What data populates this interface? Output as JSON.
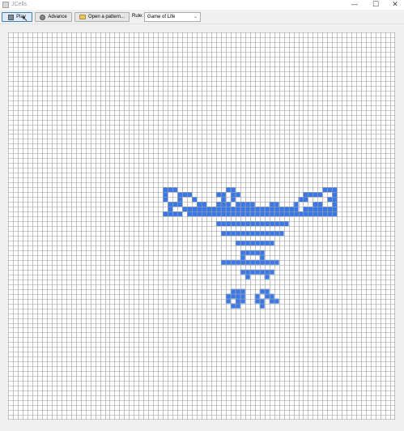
{
  "window": {
    "title": "JCells",
    "minimize_glyph": "—",
    "maximize_glyph": "☐",
    "close_glyph": "✕"
  },
  "toolbar": {
    "play_label": "Play",
    "advance_label": "Advance",
    "open_label": "Open a pattern...",
    "rule_label": "Rule:",
    "rule_value": "Game of Life"
  },
  "icons": {
    "play": "play-icon",
    "advance": "advance-icon",
    "open": "folder-icon"
  },
  "colors": {
    "live_cell": "#3b78e7",
    "grid_line": "#9a9a9a",
    "background": "#ffffff"
  },
  "board": {
    "cols": 80,
    "rows": 80,
    "live_cells": [
      [
        65,
        32
      ],
      [
        66,
        32
      ],
      [
        67,
        32
      ],
      [
        61,
        33
      ],
      [
        62,
        33
      ],
      [
        63,
        33
      ],
      [
        64,
        33
      ],
      [
        67,
        33
      ],
      [
        35,
        33
      ],
      [
        36,
        33
      ],
      [
        37,
        33
      ],
      [
        35,
        34
      ],
      [
        38,
        34
      ],
      [
        60,
        34
      ],
      [
        61,
        34
      ],
      [
        66,
        34
      ],
      [
        67,
        34
      ],
      [
        54,
        35
      ],
      [
        55,
        35
      ],
      [
        59,
        35
      ],
      [
        63,
        35
      ],
      [
        64,
        35
      ],
      [
        67,
        35
      ],
      [
        45,
        32
      ],
      [
        46,
        32
      ],
      [
        43,
        33
      ],
      [
        44,
        33
      ],
      [
        46,
        33
      ],
      [
        47,
        33
      ],
      [
        44,
        34
      ],
      [
        46,
        34
      ],
      [
        44,
        35
      ],
      [
        45,
        35
      ],
      [
        47,
        35
      ],
      [
        48,
        35
      ],
      [
        49,
        35
      ],
      [
        50,
        35
      ],
      [
        39,
        35
      ],
      [
        40,
        35
      ],
      [
        43,
        35
      ],
      [
        32,
        32
      ],
      [
        33,
        32
      ],
      [
        34,
        32
      ],
      [
        32,
        33
      ],
      [
        35,
        33
      ],
      [
        32,
        34
      ],
      [
        33,
        35
      ],
      [
        34,
        35
      ],
      [
        35,
        35
      ],
      [
        33,
        36
      ],
      [
        36,
        36
      ],
      [
        38,
        36
      ],
      [
        37,
        36
      ],
      [
        38,
        36
      ],
      [
        39,
        36
      ],
      [
        40,
        36
      ],
      [
        41,
        36
      ],
      [
        42,
        36
      ],
      [
        43,
        36
      ],
      [
        44,
        36
      ],
      [
        45,
        36
      ],
      [
        46,
        36
      ],
      [
        47,
        36
      ],
      [
        48,
        36
      ],
      [
        49,
        36
      ],
      [
        50,
        36
      ],
      [
        51,
        36
      ],
      [
        52,
        36
      ],
      [
        53,
        36
      ],
      [
        54,
        36
      ],
      [
        55,
        36
      ],
      [
        56,
        36
      ],
      [
        57,
        36
      ],
      [
        58,
        36
      ],
      [
        59,
        36
      ],
      [
        61,
        36
      ],
      [
        62,
        36
      ],
      [
        63,
        36
      ],
      [
        64,
        36
      ],
      [
        65,
        36
      ],
      [
        66,
        36
      ],
      [
        67,
        36
      ],
      [
        32,
        37
      ],
      [
        33,
        37
      ],
      [
        34,
        37
      ],
      [
        35,
        37
      ],
      [
        37,
        37
      ],
      [
        38,
        37
      ],
      [
        39,
        37
      ],
      [
        40,
        37
      ],
      [
        41,
        37
      ],
      [
        42,
        37
      ],
      [
        43,
        37
      ],
      [
        44,
        37
      ],
      [
        45,
        37
      ],
      [
        46,
        37
      ],
      [
        47,
        37
      ],
      [
        48,
        37
      ],
      [
        49,
        37
      ],
      [
        50,
        37
      ],
      [
        51,
        37
      ],
      [
        52,
        37
      ],
      [
        53,
        37
      ],
      [
        54,
        37
      ],
      [
        55,
        37
      ],
      [
        56,
        37
      ],
      [
        57,
        37
      ],
      [
        58,
        37
      ],
      [
        59,
        37
      ],
      [
        60,
        37
      ],
      [
        61,
        37
      ],
      [
        62,
        37
      ],
      [
        63,
        37
      ],
      [
        64,
        37
      ],
      [
        65,
        37
      ],
      [
        66,
        37
      ],
      [
        67,
        37
      ],
      [
        43,
        39
      ],
      [
        44,
        39
      ],
      [
        45,
        39
      ],
      [
        46,
        39
      ],
      [
        47,
        39
      ],
      [
        48,
        39
      ],
      [
        49,
        39
      ],
      [
        50,
        39
      ],
      [
        51,
        39
      ],
      [
        52,
        39
      ],
      [
        53,
        39
      ],
      [
        54,
        39
      ],
      [
        55,
        39
      ],
      [
        56,
        39
      ],
      [
        57,
        39
      ],
      [
        44,
        41
      ],
      [
        45,
        41
      ],
      [
        46,
        41
      ],
      [
        47,
        41
      ],
      [
        48,
        41
      ],
      [
        49,
        41
      ],
      [
        50,
        41
      ],
      [
        51,
        41
      ],
      [
        52,
        41
      ],
      [
        53,
        41
      ],
      [
        54,
        41
      ],
      [
        55,
        41
      ],
      [
        56,
        41
      ],
      [
        47,
        43
      ],
      [
        48,
        43
      ],
      [
        49,
        43
      ],
      [
        50,
        43
      ],
      [
        51,
        43
      ],
      [
        52,
        43
      ],
      [
        53,
        43
      ],
      [
        54,
        43
      ],
      [
        48,
        45
      ],
      [
        49,
        45
      ],
      [
        50,
        45
      ],
      [
        51,
        45
      ],
      [
        52,
        45
      ],
      [
        48,
        46
      ],
      [
        52,
        46
      ],
      [
        44,
        47
      ],
      [
        45,
        47
      ],
      [
        46,
        47
      ],
      [
        47,
        47
      ],
      [
        48,
        47
      ],
      [
        49,
        47
      ],
      [
        50,
        47
      ],
      [
        51,
        47
      ],
      [
        52,
        47
      ],
      [
        53,
        47
      ],
      [
        54,
        47
      ],
      [
        55,
        47
      ],
      [
        48,
        49
      ],
      [
        49,
        49
      ],
      [
        50,
        49
      ],
      [
        51,
        49
      ],
      [
        52,
        49
      ],
      [
        53,
        49
      ],
      [
        54,
        49
      ],
      [
        49,
        50
      ],
      [
        53,
        50
      ],
      [
        46,
        53
      ],
      [
        47,
        53
      ],
      [
        48,
        53
      ],
      [
        52,
        53
      ],
      [
        53,
        53
      ],
      [
        45,
        54
      ],
      [
        46,
        54
      ],
      [
        47,
        54
      ],
      [
        48,
        54
      ],
      [
        51,
        54
      ],
      [
        53,
        54
      ],
      [
        54,
        54
      ],
      [
        45,
        55
      ],
      [
        47,
        55
      ],
      [
        48,
        55
      ],
      [
        51,
        55
      ],
      [
        52,
        55
      ],
      [
        54,
        55
      ],
      [
        55,
        55
      ],
      [
        46,
        56
      ],
      [
        47,
        56
      ],
      [
        52,
        56
      ]
    ]
  }
}
